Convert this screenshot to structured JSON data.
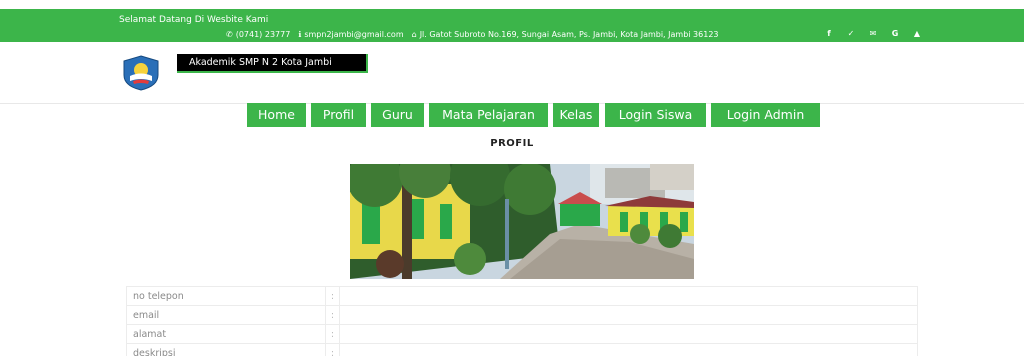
{
  "topbar": {
    "welcome": "Selamat Datang Di Wesbite Kami",
    "phone": "(0741) 23777",
    "email": "smpn2jambi@gmail.com",
    "address": "Jl. Gatot Subroto No.169, Sungai Asam, Ps. Jambi, Kota Jambi, Jambi 36123",
    "social_icons": [
      "facebook-icon",
      "twitter-icon",
      "mail-icon",
      "google-icon",
      "youtube-icon"
    ],
    "social_glyphs": [
      "f",
      "✓",
      "✉",
      "G",
      "▲"
    ],
    "color": "#3cb54a"
  },
  "header": {
    "site_name": "Akademik SMP N 2 Kota Jambi"
  },
  "nav": {
    "items": [
      "Home",
      "Profil",
      "Guru",
      "Mata Pelajaran",
      "Kelas",
      "Login Siswa",
      "Login Admin"
    ]
  },
  "main": {
    "title": "PROFIL",
    "info_rows": [
      {
        "label": "no telepon",
        "sep": ":",
        "value": ""
      },
      {
        "label": "email",
        "sep": ":",
        "value": ""
      },
      {
        "label": "alamat",
        "sep": ":",
        "value": ""
      },
      {
        "label": "deskripsi",
        "sep": ":",
        "value": ""
      }
    ]
  }
}
